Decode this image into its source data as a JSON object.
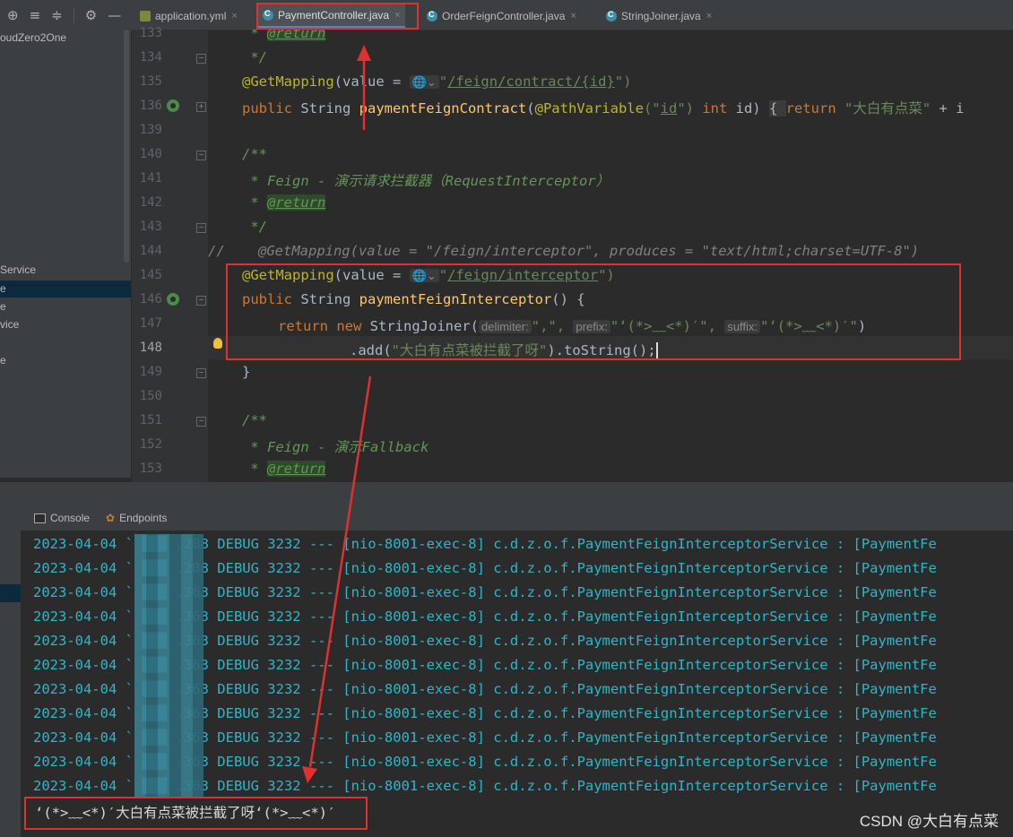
{
  "toolbar": {
    "icons": [
      "locate-icon",
      "collapse-all-icon",
      "expand-all-icon",
      "gear-icon",
      "minimize-icon"
    ]
  },
  "tabs": [
    {
      "label": "application.yml",
      "icon": "yaml-file-icon",
      "active": false
    },
    {
      "label": "PaymentController.java",
      "icon": "class-icon",
      "active": true
    },
    {
      "label": "OrderFeignController.java",
      "icon": "class-icon",
      "active": false
    },
    {
      "label": "StringJoiner.java",
      "icon": "class-icon",
      "active": false
    }
  ],
  "sidebar": {
    "project_name": "oudZero2One",
    "items": [
      "Service",
      "e",
      "e",
      "vice",
      "e"
    ]
  },
  "editor": {
    "line_numbers": [
      "133",
      "134",
      "135",
      "136",
      "139",
      "140",
      "141",
      "142",
      "143",
      "144",
      "145",
      "146",
      "147",
      "148",
      "149",
      "150",
      "151",
      "152",
      "153"
    ],
    "current_line": "148",
    "lines": {
      "l133_prefix": " * ",
      "l133_tag": "@return",
      "l134": " */",
      "l135_anno": "@GetMapping",
      "l135_a": "(value = ",
      "l135_path": "/feign/contract/{id}",
      "l135_b": "\")",
      "l136_kw": "public",
      "l136_a": " String ",
      "l136_fn": "paymentFeignContract",
      "l136_b": "(",
      "l136_anno": "@PathVariable",
      "l136_c": "(\"",
      "l136_id": "id",
      "l136_d": "\") ",
      "l136_int": "int",
      "l136_e": " id) ",
      "l136_f": "{ ",
      "l136_ret": "return",
      "l136_str": " \"大白有点菜\"",
      "l136_g": " + i",
      "l140": "/**",
      "l141": " * Feign - 演示请求拦截器（RequestInterceptor）",
      "l142_prefix": " * ",
      "l142_tag": "@return",
      "l143": " */",
      "l144": "//    @GetMapping(value = \"/feign/interceptor\", produces = \"text/html;charset=UTF-8\")",
      "l145_anno": "@GetMapping",
      "l145_a": "(value = ",
      "l145_path": "/feign/interceptor",
      "l145_b": "\")",
      "l146_kw": "public",
      "l146_a": " String ",
      "l146_fn": "paymentFeignInterceptor",
      "l146_b": "() {",
      "l147_ret": "return",
      "l147_new": " new",
      "l147_a": " StringJoiner(",
      "l147_h1": "delimiter:",
      "l147_s1": "\",\",",
      "l147_h2": "prefix:",
      "l147_s2": "\"‘(*>﹏<*)′\",",
      "l147_h3": "suffix:",
      "l147_s3": "\"‘(*>﹏<*)′\"",
      "l147_b": ")",
      "l148_a": ".add(",
      "l148_str": "\"大白有点菜被拦截了呀\"",
      "l148_b": ").toString();",
      "l149": "}",
      "l151": "/**",
      "l152_a": " * Feign - 演示",
      "l152_b": "Fallback",
      "l153_prefix": " * ",
      "l153_tag": "@return"
    }
  },
  "bottom_tabs": [
    {
      "label": "Console",
      "icon": "console-icon"
    },
    {
      "label": "Endpoints",
      "icon": "endpoints-icon"
    }
  ],
  "console": {
    "log_lines": [
      "2023-04-04 ` ███ .288 DEBUG 3232 --- [nio-8001-exec-8] c.d.z.o.f.PaymentFeignInterceptorService : [PaymentFe",
      "2023-04-04 ` ███ .288 DEBUG 3232 --- [nio-8001-exec-8] c.d.z.o.f.PaymentFeignInterceptorService : [PaymentFe",
      "2023-04-04 ` ███ .363 DEBUG 3232 --- [nio-8001-exec-8] c.d.z.o.f.PaymentFeignInterceptorService : [PaymentFe",
      "2023-04-04 ` ███ .363 DEBUG 3232 --- [nio-8001-exec-8] c.d.z.o.f.PaymentFeignInterceptorService : [PaymentFe",
      "2023-04-04 ` ███ .363 DEBUG 3232 --- [nio-8001-exec-8] c.d.z.o.f.PaymentFeignInterceptorService : [PaymentFe",
      "2023-04-04 ` ███ .363 DEBUG 3232 --- [nio-8001-exec-8] c.d.z.o.f.PaymentFeignInterceptorService : [PaymentFe",
      "2023-04-04 ` ███ .363 DEBUG 3232 --- [nio-8001-exec-8] c.d.z.o.f.PaymentFeignInterceptorService : [PaymentFe",
      "2023-04-04 ` ███ .363 DEBUG 3232 --- [nio-8001-exec-8] c.d.z.o.f.PaymentFeignInterceptorService : [PaymentFe",
      "2023-04-04 ` ███ .363 DEBUG 3232 --- [nio-8001-exec-8] c.d.z.o.f.PaymentFeignInterceptorService : [PaymentFe",
      "2023-04-04 ` ███ .363 DEBUG 3232 --- [nio-8001-exec-8] c.d.z.o.f.PaymentFeignInterceptorService : [PaymentFe",
      "2023-04-04 ` ███ .363 DEBUG 3232 --- [nio-8001-exec-8] c.d.z.o.f.PaymentFeignInterceptorService : [PaymentFe"
    ],
    "output": "‘(*>﹏<*)′大白有点菜被拦截了呀‘(*>﹏<*)′"
  },
  "watermark": "CSDN @大白有点菜",
  "colors": {
    "annotation_red": "#e03030",
    "log_cyan": "#2fb5c7"
  }
}
